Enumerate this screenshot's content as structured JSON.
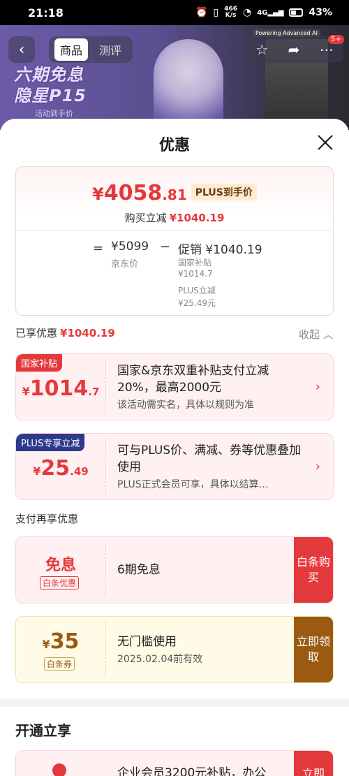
{
  "status": {
    "time": "21:18",
    "net_speed_top": "466",
    "net_speed_unit": "K/s",
    "network": "4G",
    "battery": "43%"
  },
  "banner": {
    "title_line1": "六期免息",
    "title_line2": "隐星P15",
    "subtitle": "活动到手价",
    "tag": "Powering Advanced AI"
  },
  "nav": {
    "tabs": [
      {
        "label": "商品"
      },
      {
        "label": "测评"
      }
    ],
    "badge": "5+"
  },
  "sheet": {
    "title": "优惠",
    "summary": {
      "price_yen": "¥",
      "price_int": "4058",
      "price_dec": ".81",
      "plus_tag": "PLUS到手价",
      "reduce_label": "购买立减",
      "reduce_value": "¥1040.19",
      "eq": "=",
      "base_price": "¥5099",
      "base_label": "京东价",
      "minus": "−",
      "promo": "促销 ¥1040.19",
      "sub_items": [
        {
          "label": "国家补贴",
          "value": "¥1014.7"
        },
        {
          "label": "PLUS立减",
          "value": "¥25.49元"
        }
      ]
    },
    "enjoyed": {
      "label": "已享优惠",
      "value": "¥1040.19",
      "collapse": "收起"
    },
    "coupons": [
      {
        "tag": "国家补贴",
        "yen": "¥",
        "int": "1014",
        "dec": ".7",
        "title": "国家&京东双重补贴支付立减20%，最高2000元",
        "desc": "该活动需实名，具体以规则为准",
        "accent": "#e4393c"
      },
      {
        "tag": "PLUS专享立减",
        "yen": "¥",
        "int": "25",
        "dec": ".49",
        "title": "可与PLUS价、满减、券等优惠叠加使用",
        "desc": "PLUS正式会员可享，具体以结算…",
        "accent": "#2d3a8c"
      }
    ],
    "pay_section_label": "支付再享优惠",
    "pay_offers": [
      {
        "big": "免息",
        "small": "白条优惠",
        "title": "6期免息",
        "button": "白条购买",
        "button_color": "#e4393c"
      },
      {
        "yen": "¥",
        "big": "35",
        "small": "白条券",
        "title": "无门槛使用",
        "desc": "2025.02.04前有效",
        "button": "立即领取",
        "button_color": "#9a5a12"
      }
    ],
    "open_section": {
      "title": "开通立享",
      "item_text": "企业会员3200元补贴，办公",
      "button": "立即"
    }
  }
}
